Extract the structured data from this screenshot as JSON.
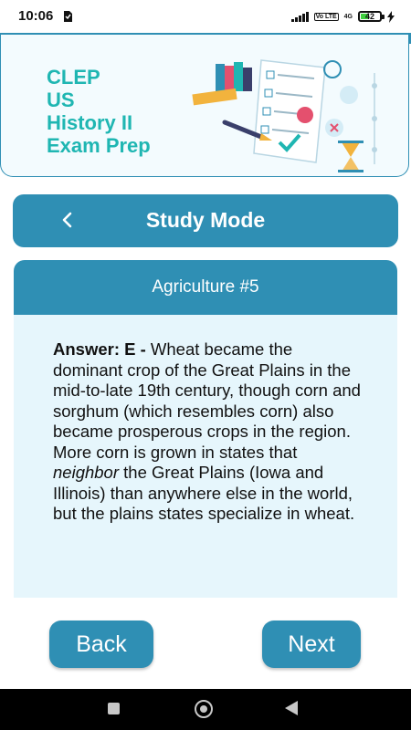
{
  "status_bar": {
    "time": "10:06",
    "network_label": "Vo LTE",
    "signal_label": "4G",
    "battery": "42",
    "battery_level": 0.42
  },
  "header": {
    "title_lines": [
      "CLEP",
      "US",
      "History II",
      "Exam Prep"
    ]
  },
  "mode_bar": {
    "title": "Study Mode",
    "back_icon": "chevron-left-icon"
  },
  "card": {
    "title": "Agriculture #5",
    "answer_label": "Answer: E - ",
    "answer_text_1": "Wheat became the dominant crop of the Great Plains in the mid-to-late 19th century, though corn and sorghum (which resembles corn) also became prosperous crops in the region. More corn is grown in states that ",
    "answer_emphasis": "neighbor",
    "answer_text_2": " the Great Plains (Iowa and Illinois) than anywhere else in the world, but the plains states specialize in wheat."
  },
  "buttons": {
    "back": "Back",
    "next": "Next"
  },
  "colors": {
    "accent": "#2f8fb4",
    "title_teal": "#1fb6b2",
    "card_bg": "#e6f6fc"
  }
}
